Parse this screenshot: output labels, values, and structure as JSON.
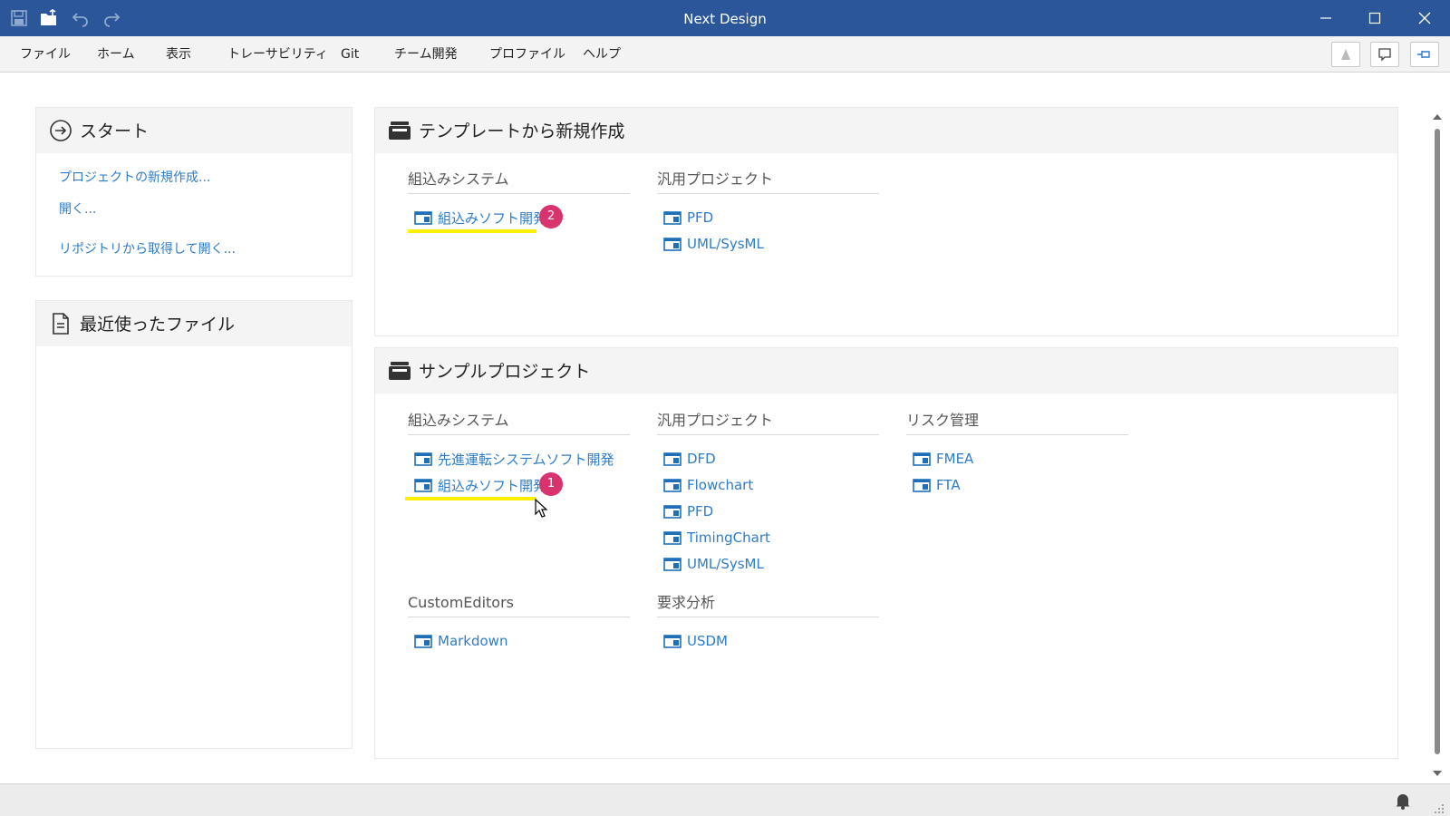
{
  "window": {
    "title": "Next Design"
  },
  "menu": {
    "items": [
      "ファイル",
      "ホーム",
      "表示",
      "トレーサビリティ",
      "Git",
      "チーム開発",
      "プロファイル",
      "ヘルプ"
    ]
  },
  "start_panel": {
    "title": "スタート",
    "links": [
      "プロジェクトの新規作成...",
      "開く...",
      "リポジトリから取得して開く..."
    ]
  },
  "recent_panel": {
    "title": "最近使ったファイル"
  },
  "template_panel": {
    "title": "テンプレートから新規作成",
    "groups": [
      {
        "heading": "組込みシステム",
        "items": [
          "組込みソフト開発"
        ]
      },
      {
        "heading": "汎用プロジェクト",
        "items": [
          "PFD",
          "UML/SysML"
        ]
      }
    ],
    "badge": "2"
  },
  "sample_panel": {
    "title": "サンプルプロジェクト",
    "groups": [
      {
        "heading": "組込みシステム",
        "items": [
          "先進運転システムソフト開発",
          "組込みソフト開発"
        ]
      },
      {
        "heading": "汎用プロジェクト",
        "items": [
          "DFD",
          "Flowchart",
          "PFD",
          "TimingChart",
          "UML/SysML"
        ]
      },
      {
        "heading": "リスク管理",
        "items": [
          "FMEA",
          "FTA"
        ]
      },
      {
        "heading": "CustomEditors",
        "items": [
          "Markdown"
        ]
      },
      {
        "heading": "要求分析",
        "items": [
          "USDM"
        ]
      }
    ],
    "badge": "1"
  },
  "colors": {
    "titlebar": "#2b579a",
    "link": "#2e7cc9",
    "badge": "#d8326f",
    "highlight": "#ffee00",
    "project_icon": "#1e6fb8"
  },
  "icons": {
    "qat": [
      "save-icon",
      "open-folder-icon",
      "undo-icon",
      "redo-icon"
    ],
    "window_controls": [
      "minimize-icon",
      "maximize-icon",
      "close-icon"
    ],
    "menubar_right": [
      "app-icon",
      "feedback-icon",
      "pin-icon"
    ],
    "status": [
      "notification-bell-icon",
      "resize-grip-icon"
    ]
  }
}
